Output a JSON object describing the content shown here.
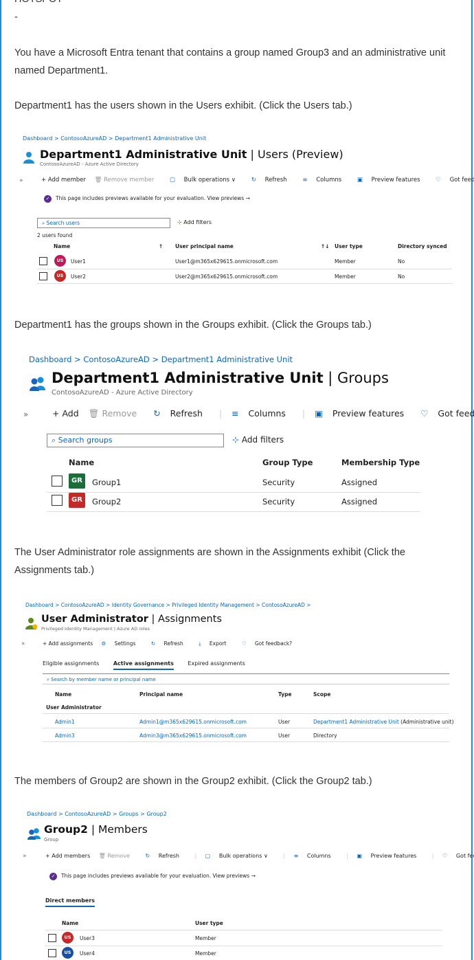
{
  "top": {
    "cut_heading": "HOTSPOT",
    "dash": "-"
  },
  "paragraphs": {
    "p1": "You have a Microsoft Entra tenant that contains a group named Group3 and an administrative unit named Department1.",
    "p2": "Department1 has the users shown in the Users exhibit. (Click the Users tab.)",
    "p3": "Department1 has the groups shown in the Groups exhibit. (Click the Groups tab.)",
    "p4": "The User Administrator role assignments are shown in the Assignments exhibit (Click the Assignments tab.)",
    "p5": "The members of Group2 are shown in the Group2 exhibit. (Click the Group2 tab.)"
  },
  "users": {
    "crumbs": [
      "Dashboard",
      "ContosoAzureAD",
      "Department1 Administrative Unit"
    ],
    "title_bold": "Department1 Administrative Unit",
    "title_rest": " | Users (Preview)",
    "subtitle": "ContosoAzureAD - Azure Active Directory",
    "toolbar": {
      "add": "+ Add member",
      "remove": "Remove member",
      "bulk": "Bulk operations ∨",
      "refresh": "Refresh",
      "columns": "Columns",
      "preview": "Preview features",
      "feedback": "Got feedback?"
    },
    "notice": "This page includes previews available for your evaluation. View previews →",
    "search_placeholder": "Search users",
    "add_filters": "Add filters",
    "count": "2 users found",
    "headers": {
      "name": "Name",
      "upn": "User principal name",
      "type": "User type",
      "sync": "Directory synced"
    },
    "rows": [
      {
        "initials": "US",
        "name": "User1",
        "upn": "User1@m365x629615.onmicrosoft.com",
        "type": "Member",
        "sync": "No"
      },
      {
        "initials": "US",
        "name": "User2",
        "upn": "User2@m365x629615.onmicrosoft.com",
        "type": "Member",
        "sync": "No"
      }
    ],
    "avatar_colors": [
      "#c2185b",
      "#c62828"
    ]
  },
  "groups": {
    "crumbs": [
      "Dashboard",
      "ContosoAzureAD",
      "Department1 Administrative Unit"
    ],
    "title_bold": "Department1 Administrative Unit",
    "title_rest": " | Groups",
    "subtitle": "ContosoAzureAD - Azure Active Directory",
    "toolbar": {
      "add": "+ Add",
      "remove": "Remove",
      "refresh": "Refresh",
      "columns": "Columns",
      "preview": "Preview features",
      "feedback": "Got feedback?"
    },
    "search_placeholder": "Search groups",
    "add_filters": "Add filters",
    "headers": {
      "name": "Name",
      "gtype": "Group Type",
      "mtype": "Membership Type"
    },
    "rows": [
      {
        "initials": "GR",
        "name": "Group1",
        "gtype": "Security",
        "mtype": "Assigned"
      },
      {
        "initials": "GR",
        "name": "Group2",
        "gtype": "Security",
        "mtype": "Assigned"
      }
    ],
    "colors": [
      "#1b6e3a",
      "#c62828"
    ]
  },
  "assignments": {
    "crumbs": [
      "Dashboard",
      "ContosoAzureAD",
      "Identity Governance",
      "Privileged Identity Management",
      "ContosoAzureAD",
      ""
    ],
    "title_bold": "User Administrator",
    "title_rest": " | Assignments",
    "subtitle": "Privileged Identity Management | Azure AD roles",
    "toolbar": {
      "add": "+ Add assignments",
      "settings": "Settings",
      "refresh": "Refresh",
      "export": "Export",
      "feedback": "Got feedback?"
    },
    "tabs": [
      "Eligible assignments",
      "Active assignments",
      "Expired assignments"
    ],
    "search_placeholder": "Search by member name or principal name",
    "headers": {
      "name": "Name",
      "principal": "Principal name",
      "type": "Type",
      "scope": "Scope"
    },
    "group_label": "User Administrator",
    "rows": [
      {
        "name": "Admin1",
        "principal": "Admin1@m365x629615.onmicrosoft.com",
        "type": "User",
        "scope_link": "Department1 Administrative Unit",
        "scope_rest": " (Administrative unit)"
      },
      {
        "name": "Admin3",
        "principal": "Admin3@m365x629615.onmicrosoft.com",
        "type": "User",
        "scope_link": "",
        "scope_rest": "Directory"
      }
    ]
  },
  "group2": {
    "crumbs": [
      "Dashboard",
      "ContosoAzureAD",
      "Groups",
      "Group2"
    ],
    "title_bold": "Group2",
    "title_rest": " | Members",
    "subtitle": "Group",
    "toolbar": {
      "add": "+ Add members",
      "remove": "Remove",
      "refresh": "Refresh",
      "bulk": "Bulk operations ∨",
      "columns": "Columns",
      "preview": "Preview features",
      "feedback": "Got feedback?"
    },
    "notice": "This page includes previews available for your evaluation. View previews →",
    "tab": "Direct members",
    "headers": {
      "name": "Name",
      "type": "User type"
    },
    "rows": [
      {
        "initials": "US",
        "name": "User3",
        "type": "Member"
      },
      {
        "initials": "US",
        "name": "User4",
        "type": "Member"
      }
    ],
    "avatar_colors": [
      "#c62828",
      "#1a4fa0"
    ]
  }
}
